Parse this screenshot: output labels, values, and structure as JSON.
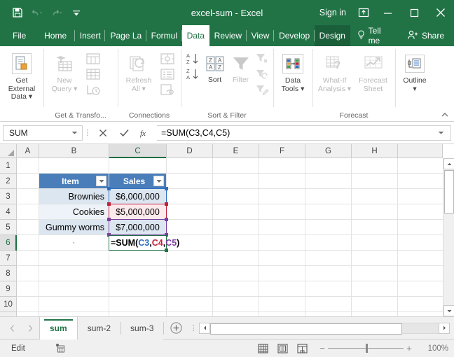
{
  "window": {
    "title": "excel-sum - Excel",
    "sign_in": "Sign in",
    "accent_green": "#217346",
    "quick_access": [
      {
        "name": "save-icon",
        "label": "Save"
      },
      {
        "name": "undo-icon",
        "label": "Undo"
      },
      {
        "name": "redo-icon",
        "label": "Redo"
      },
      {
        "name": "customize-qat-icon",
        "label": "Customize Quick Access Toolbar"
      }
    ],
    "controls": [
      {
        "name": "ribbon-display-options-icon",
        "label": "Ribbon Display Options"
      },
      {
        "name": "minimize-icon",
        "label": "Minimize"
      },
      {
        "name": "maximize-icon",
        "label": "Restore Down"
      },
      {
        "name": "close-icon",
        "label": "Close"
      }
    ]
  },
  "ribbon_tabs": [
    {
      "label": "File",
      "active": false,
      "contextual": false
    },
    {
      "label": "Home",
      "active": false,
      "contextual": false
    },
    {
      "label": "Insert",
      "active": false,
      "contextual": false
    },
    {
      "label": "Page La",
      "active": false,
      "contextual": false
    },
    {
      "label": "Formul",
      "active": false,
      "contextual": false
    },
    {
      "label": "Data",
      "active": true,
      "contextual": false
    },
    {
      "label": "Review",
      "active": false,
      "contextual": false
    },
    {
      "label": "View",
      "active": false,
      "contextual": false
    },
    {
      "label": "Develop",
      "active": false,
      "contextual": false
    },
    {
      "label": "Design",
      "active": false,
      "contextual": true
    }
  ],
  "tell_me": "Tell me",
  "share": "Share",
  "ribbon": {
    "groups": [
      {
        "label": "",
        "name": "get-external-data-group"
      },
      {
        "label": "Get & Transfo...",
        "name": "get-and-transform-group"
      },
      {
        "label": "Connections",
        "name": "connections-group"
      },
      {
        "label": "Sort & Filter",
        "name": "sort-and-filter-group"
      },
      {
        "label": "",
        "name": "data-tools-group"
      },
      {
        "label": "Forecast",
        "name": "forecast-group"
      },
      {
        "label": "",
        "name": "outline-group"
      }
    ],
    "get_external_data": "Get External\nData",
    "get_external_data_l1": "Get External",
    "get_external_data_l2": "Data",
    "new_query_l1": "New",
    "new_query_l2": "Query",
    "refresh_all_l1": "Refresh",
    "refresh_all_l2": "All",
    "sort": "Sort",
    "filter": "Filter",
    "data_tools_l1": "Data",
    "data_tools_l2": "Tools",
    "what_if_l1": "What-If",
    "what_if_l2": "Analysis",
    "forecast_sheet_l1": "Forecast",
    "forecast_sheet_l2": "Sheet",
    "outline": "Outline",
    "collapse_icon": "collapse-ribbon-icon"
  },
  "formula_bar": {
    "name_box_value": "SUM",
    "cancel_label": "Cancel",
    "enter_label": "Enter",
    "insert_function_label": "fx",
    "formula": "=SUM(C3,C4,C5)",
    "formula_parts": {
      "prefix": "=SUM(",
      "ref1": "C3",
      "sep1": ",",
      "ref2": "C4",
      "sep2": ",",
      "ref3": "C5",
      "suffix": ")"
    }
  },
  "grid": {
    "columns": [
      "A",
      "B",
      "C",
      "D",
      "E",
      "F",
      "G",
      "H"
    ],
    "selected_column": "C",
    "rows": [
      "1",
      "2",
      "3",
      "4",
      "5",
      "6",
      "7",
      "8",
      "9",
      "10"
    ],
    "selected_row": "6",
    "table": {
      "headers": [
        "Item",
        "Sales"
      ],
      "rows": [
        {
          "item": "Brownies",
          "sales": "$6,000,000"
        },
        {
          "item": "Cookies",
          "sales": "$5,000,000"
        },
        {
          "item": "Gummy worms",
          "sales": "$7,000,000"
        }
      ]
    },
    "b6_value": "·",
    "active_cell": "C6",
    "reference_colors": {
      "c3": "#2f6fc0",
      "c4": "#c0223b",
      "c5": "#7b3fa0",
      "active": "#217346"
    }
  },
  "sheet_tabs": {
    "tabs": [
      {
        "label": "sum",
        "active": true
      },
      {
        "label": "sum-2",
        "active": false
      },
      {
        "label": "sum-3",
        "active": false
      }
    ],
    "add_sheet_label": "New sheet",
    "prev_label": "Previous",
    "next_label": "Next"
  },
  "status_bar": {
    "mode": "Edit",
    "macro_record_label": "Record Macro",
    "views": [
      {
        "name": "normal-view-icon",
        "label": "Normal"
      },
      {
        "name": "page-layout-view-icon",
        "label": "Page Layout"
      },
      {
        "name": "page-break-view-icon",
        "label": "Page Break Preview"
      }
    ],
    "zoom_out": "−",
    "zoom_in": "+",
    "zoom_level": "100%"
  }
}
